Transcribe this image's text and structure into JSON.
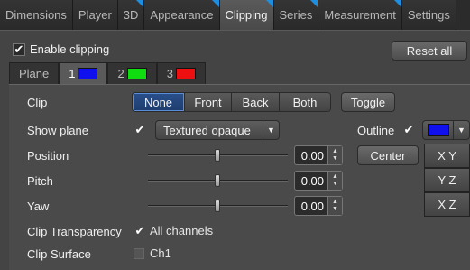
{
  "tabs": [
    {
      "label": "Dimensions",
      "flag": false,
      "active": false
    },
    {
      "label": "Player",
      "flag": false,
      "active": false
    },
    {
      "label": "3D",
      "flag": true,
      "active": false
    },
    {
      "label": "Appearance",
      "flag": true,
      "active": false
    },
    {
      "label": "Clipping",
      "flag": true,
      "active": true
    },
    {
      "label": "Series",
      "flag": true,
      "active": false
    },
    {
      "label": "Measurement",
      "flag": true,
      "active": false
    },
    {
      "label": "Settings",
      "flag": false,
      "active": false
    }
  ],
  "enable_clipping": {
    "label": "Enable clipping",
    "checked": true
  },
  "reset_all_label": "Reset all",
  "plane_tabs": {
    "label": "Plane",
    "items": [
      {
        "label": "1",
        "color": "#1010ee"
      },
      {
        "label": "2",
        "color": "#10dd10"
      },
      {
        "label": "3",
        "color": "#ee1010"
      }
    ]
  },
  "clip": {
    "label": "Clip",
    "options": [
      "None",
      "Front",
      "Back",
      "Both"
    ],
    "selected": "None",
    "toggle_label": "Toggle"
  },
  "show_plane": {
    "label": "Show plane",
    "checked": true,
    "mode": "Textured opaque"
  },
  "outline": {
    "label": "Outline",
    "checked": true,
    "color": "#1010ee"
  },
  "position": {
    "label": "Position",
    "value": "0.00",
    "slider_fraction": 0.5
  },
  "pitch": {
    "label": "Pitch",
    "value": "0.00",
    "slider_fraction": 0.5
  },
  "yaw": {
    "label": "Yaw",
    "value": "0.00",
    "slider_fraction": 0.5
  },
  "center_label": "Center",
  "axis_buttons": [
    "X Y",
    "Y Z",
    "X Z"
  ],
  "clip_transparency": {
    "label": "Clip Transparency",
    "option": "All channels",
    "checked": true
  },
  "clip_surface": {
    "label": "Clip Surface",
    "option": "Ch1",
    "checked": false
  }
}
